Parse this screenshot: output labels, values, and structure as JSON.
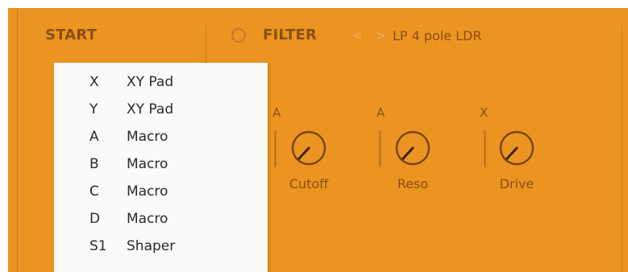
{
  "start_section": {
    "title": "START"
  },
  "filter_section": {
    "title": "FILTER",
    "nav_arrows": "< >",
    "filter_type": "LP 4 pole LDR",
    "knobs": [
      {
        "label": "Cutoff",
        "mod_source": "A"
      },
      {
        "label": "Reso",
        "mod_source": "A"
      },
      {
        "label": "Drive",
        "mod_source": "X"
      }
    ]
  },
  "menu": {
    "items": [
      {
        "key": "X",
        "label": "XY Pad"
      },
      {
        "key": "Y",
        "label": "XY Pad"
      },
      {
        "key": "A",
        "label": "Macro"
      },
      {
        "key": "B",
        "label": "Macro"
      },
      {
        "key": "C",
        "label": "Macro"
      },
      {
        "key": "D",
        "label": "Macro"
      },
      {
        "key": "S1",
        "label": "Shaper"
      }
    ]
  },
  "colors": {
    "panel_bg": "#eb9422",
    "text": "#8a4f0f",
    "menu_bg": "#fbfaf8"
  }
}
